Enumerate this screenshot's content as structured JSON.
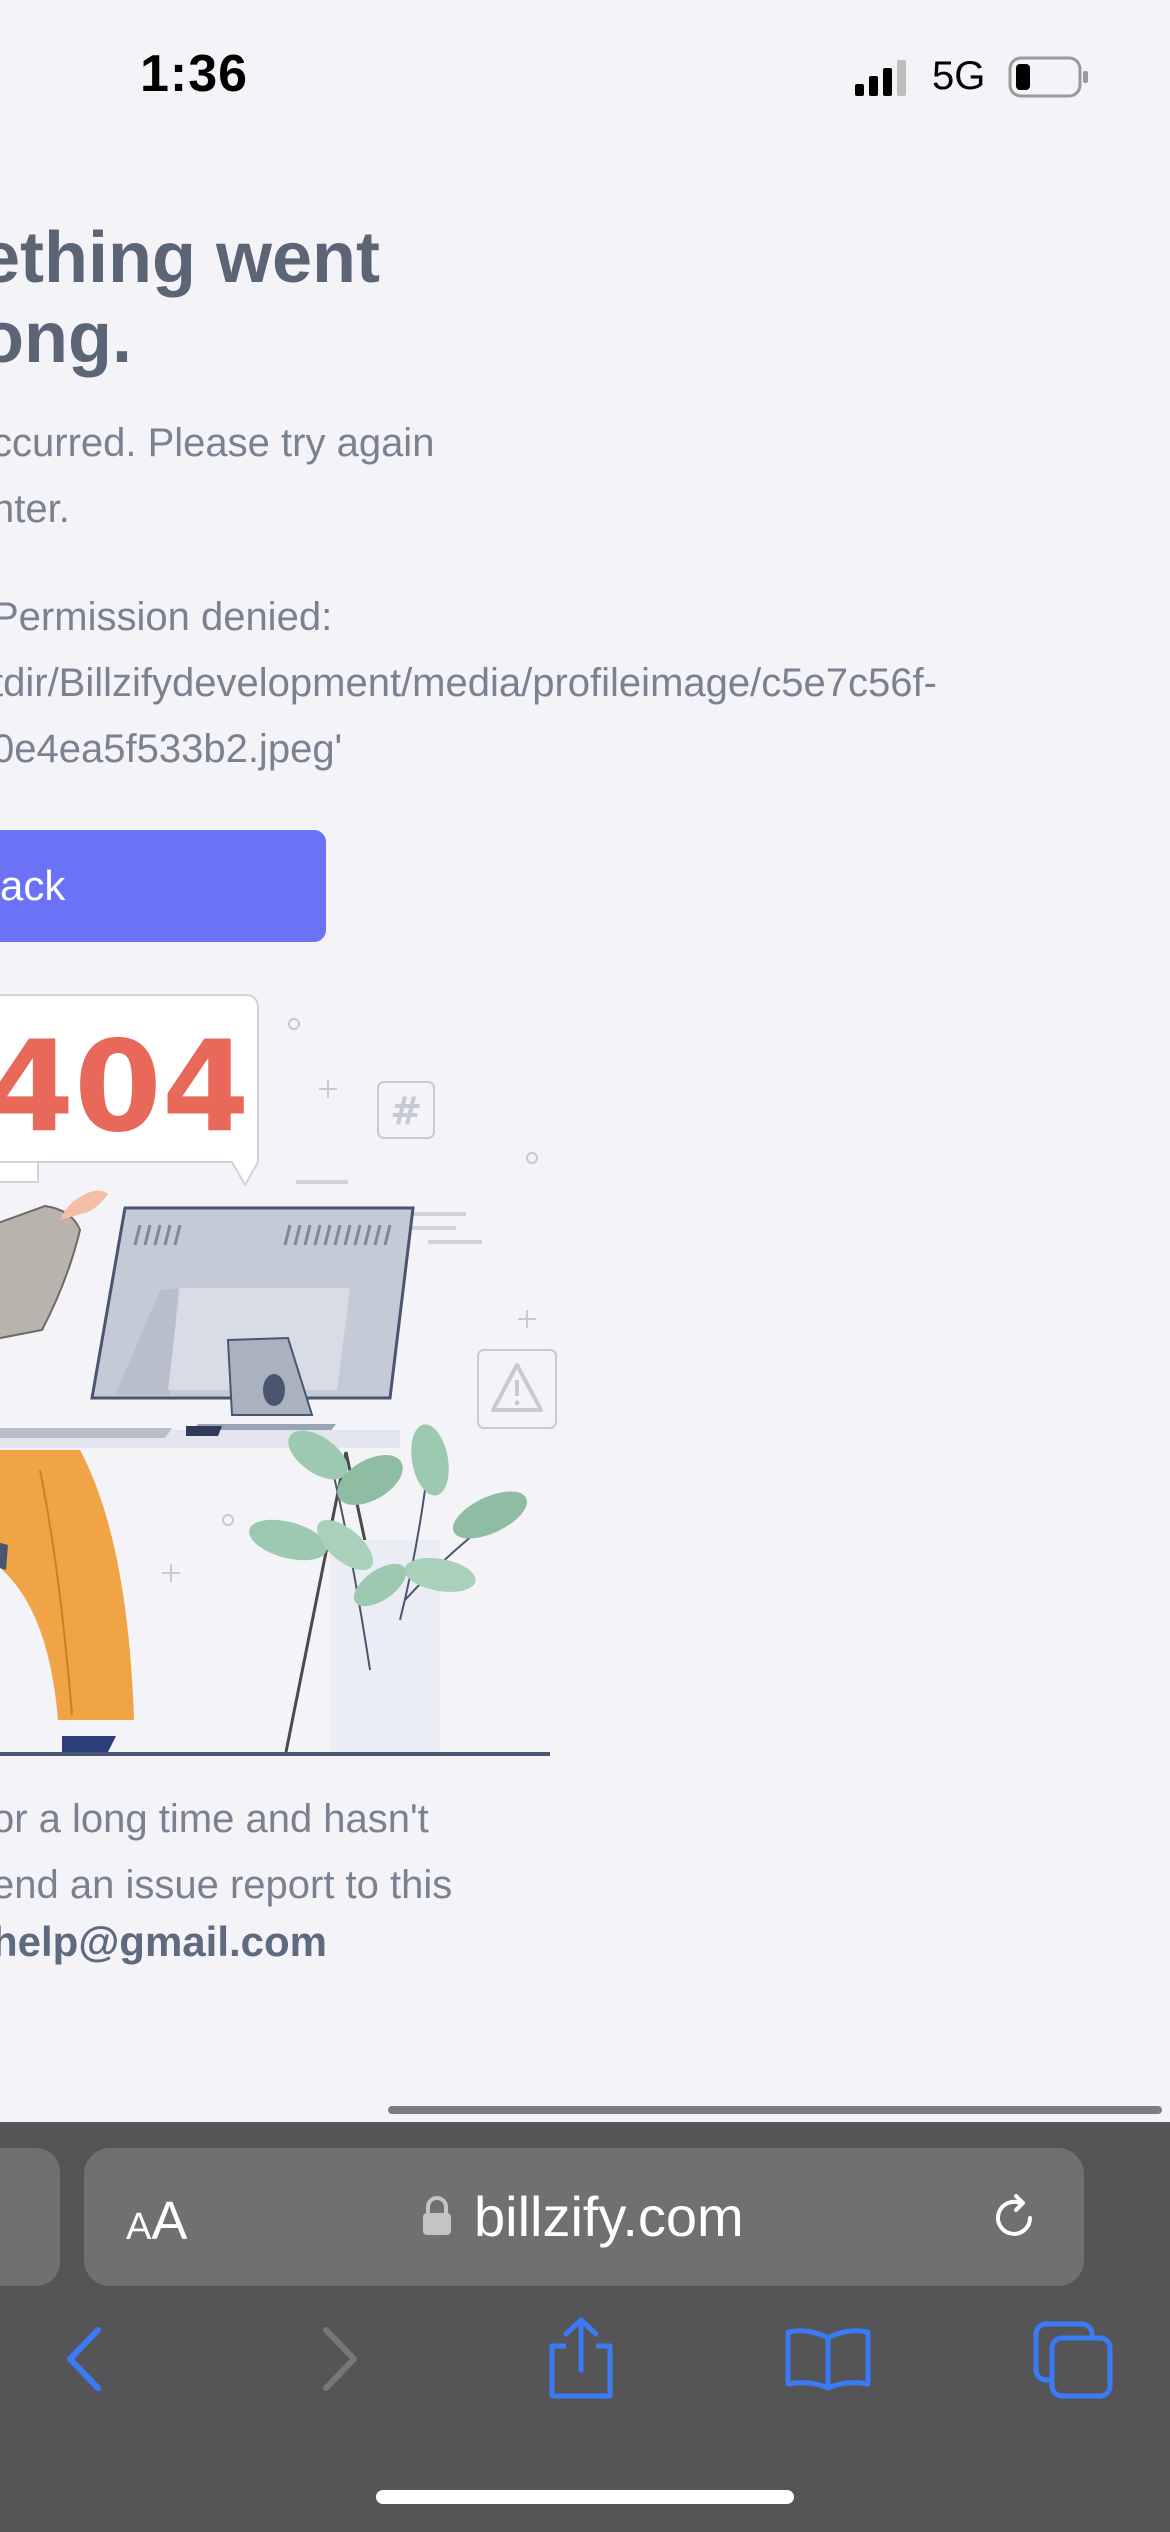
{
  "status_bar": {
    "time": "1:36",
    "network": "5G"
  },
  "error_page": {
    "heading": "ething went\nong.",
    "subtext": "ccurred. Please try again\nnter.",
    "error_message": " Permission denied:\ntdir/Billzifydevelopment/media/profileimage/c5e7c56f-\n0e4ea5f533b2.jpeg'",
    "back_button_label": "ack",
    "illustration": {
      "code_text": "404",
      "hash_symbol": "#",
      "colors": {
        "code": "#e8695a",
        "monitor": "#c5cbd6",
        "pants": "#f0a445",
        "leaves": "#9ec9b1"
      }
    },
    "footer_text": "or a long time and hasn't\nend an issue report to this",
    "footer_email": "help@gmail.com"
  },
  "browser": {
    "text_size_label_small": "A",
    "text_size_label_large": "A",
    "domain": "billzify.com",
    "icons": [
      "lock-icon",
      "reload-icon",
      "back-arrow-icon",
      "forward-arrow-icon",
      "share-icon",
      "bookmarks-icon",
      "tabs-icon"
    ],
    "accent_color": "#3a7af5"
  }
}
